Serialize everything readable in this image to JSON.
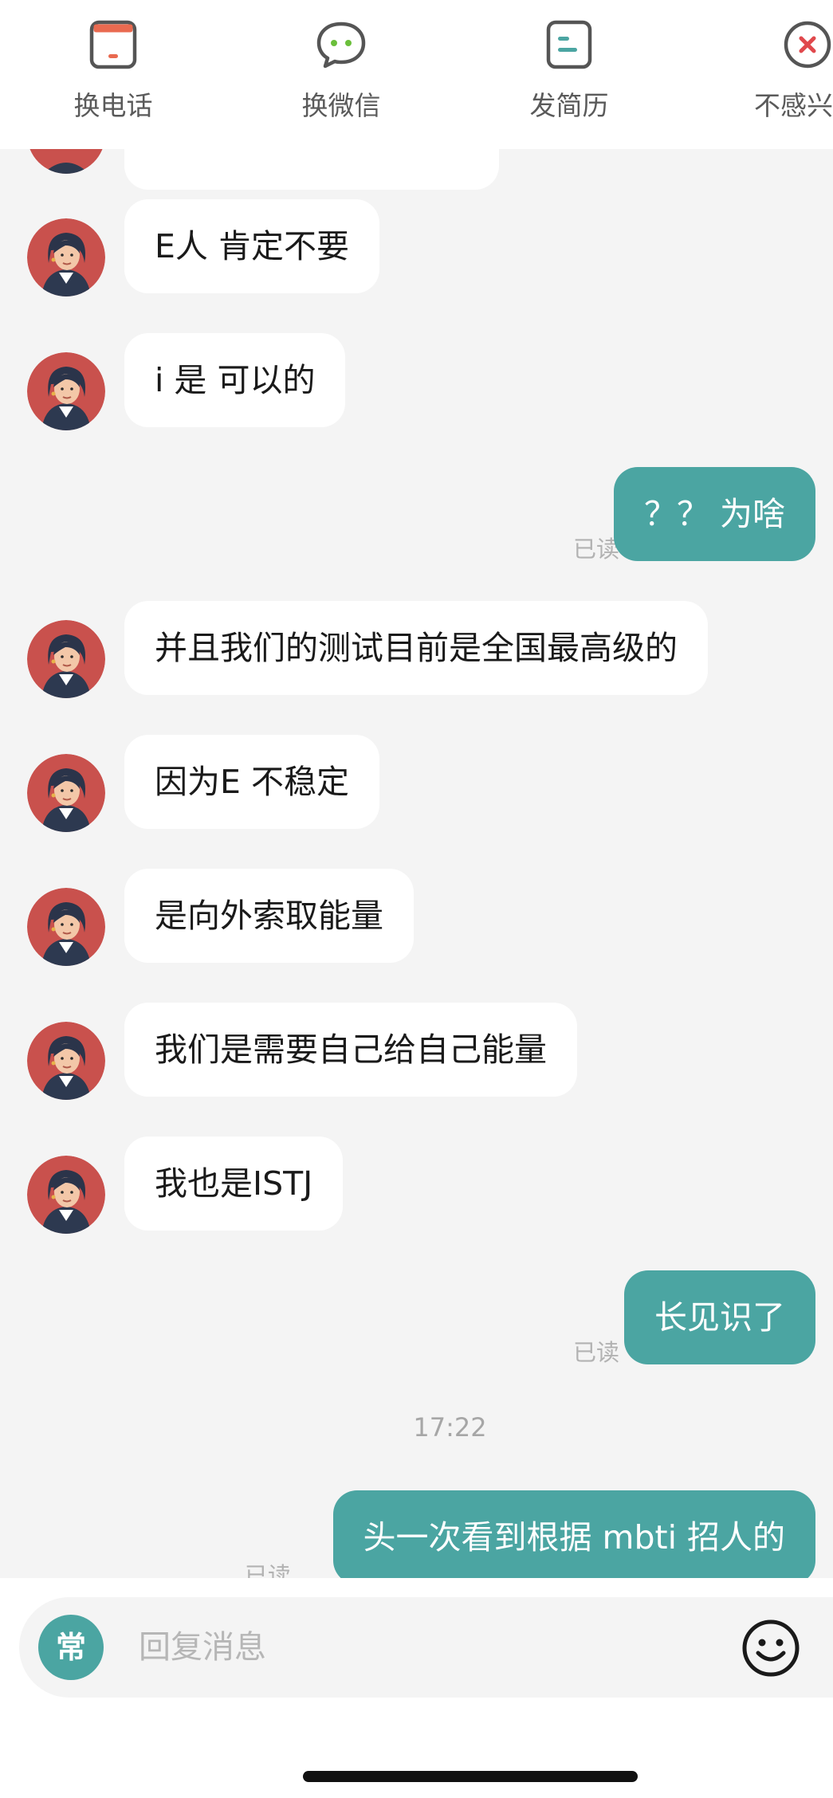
{
  "actions": [
    {
      "label": "换电话",
      "icon": "phone-card-icon"
    },
    {
      "label": "换微信",
      "icon": "wechat-bubble-icon"
    },
    {
      "label": "发简历",
      "icon": "resume-doc-icon"
    },
    {
      "label": "不感兴",
      "icon": "close-circle-icon"
    }
  ],
  "messages": [
    {
      "side": "in",
      "text": "E人 肯定不要"
    },
    {
      "side": "in",
      "text": "i 是 可以的"
    },
    {
      "side": "out",
      "text": "？？ 为啥",
      "status": "已读"
    },
    {
      "side": "in",
      "text": "并且我们的测试目前是全国最高级的"
    },
    {
      "side": "in",
      "text": "因为E 不稳定"
    },
    {
      "side": "in",
      "text": "是向外索取能量"
    },
    {
      "side": "in",
      "text": "我们是需要自己给自己能量"
    },
    {
      "side": "in",
      "text": "我也是ISTJ"
    },
    {
      "side": "out",
      "text": "长见识了",
      "status": "已读"
    },
    {
      "side": "out",
      "text": "头一次看到根据 mbti 招人的",
      "status": "已读"
    }
  ],
  "timestamp": "17:22",
  "input": {
    "quick_label": "常",
    "placeholder": "回复消息"
  },
  "colors": {
    "accent": "#4ba5a2",
    "bubble_in": "#ffffff",
    "background": "#f4f4f4"
  }
}
